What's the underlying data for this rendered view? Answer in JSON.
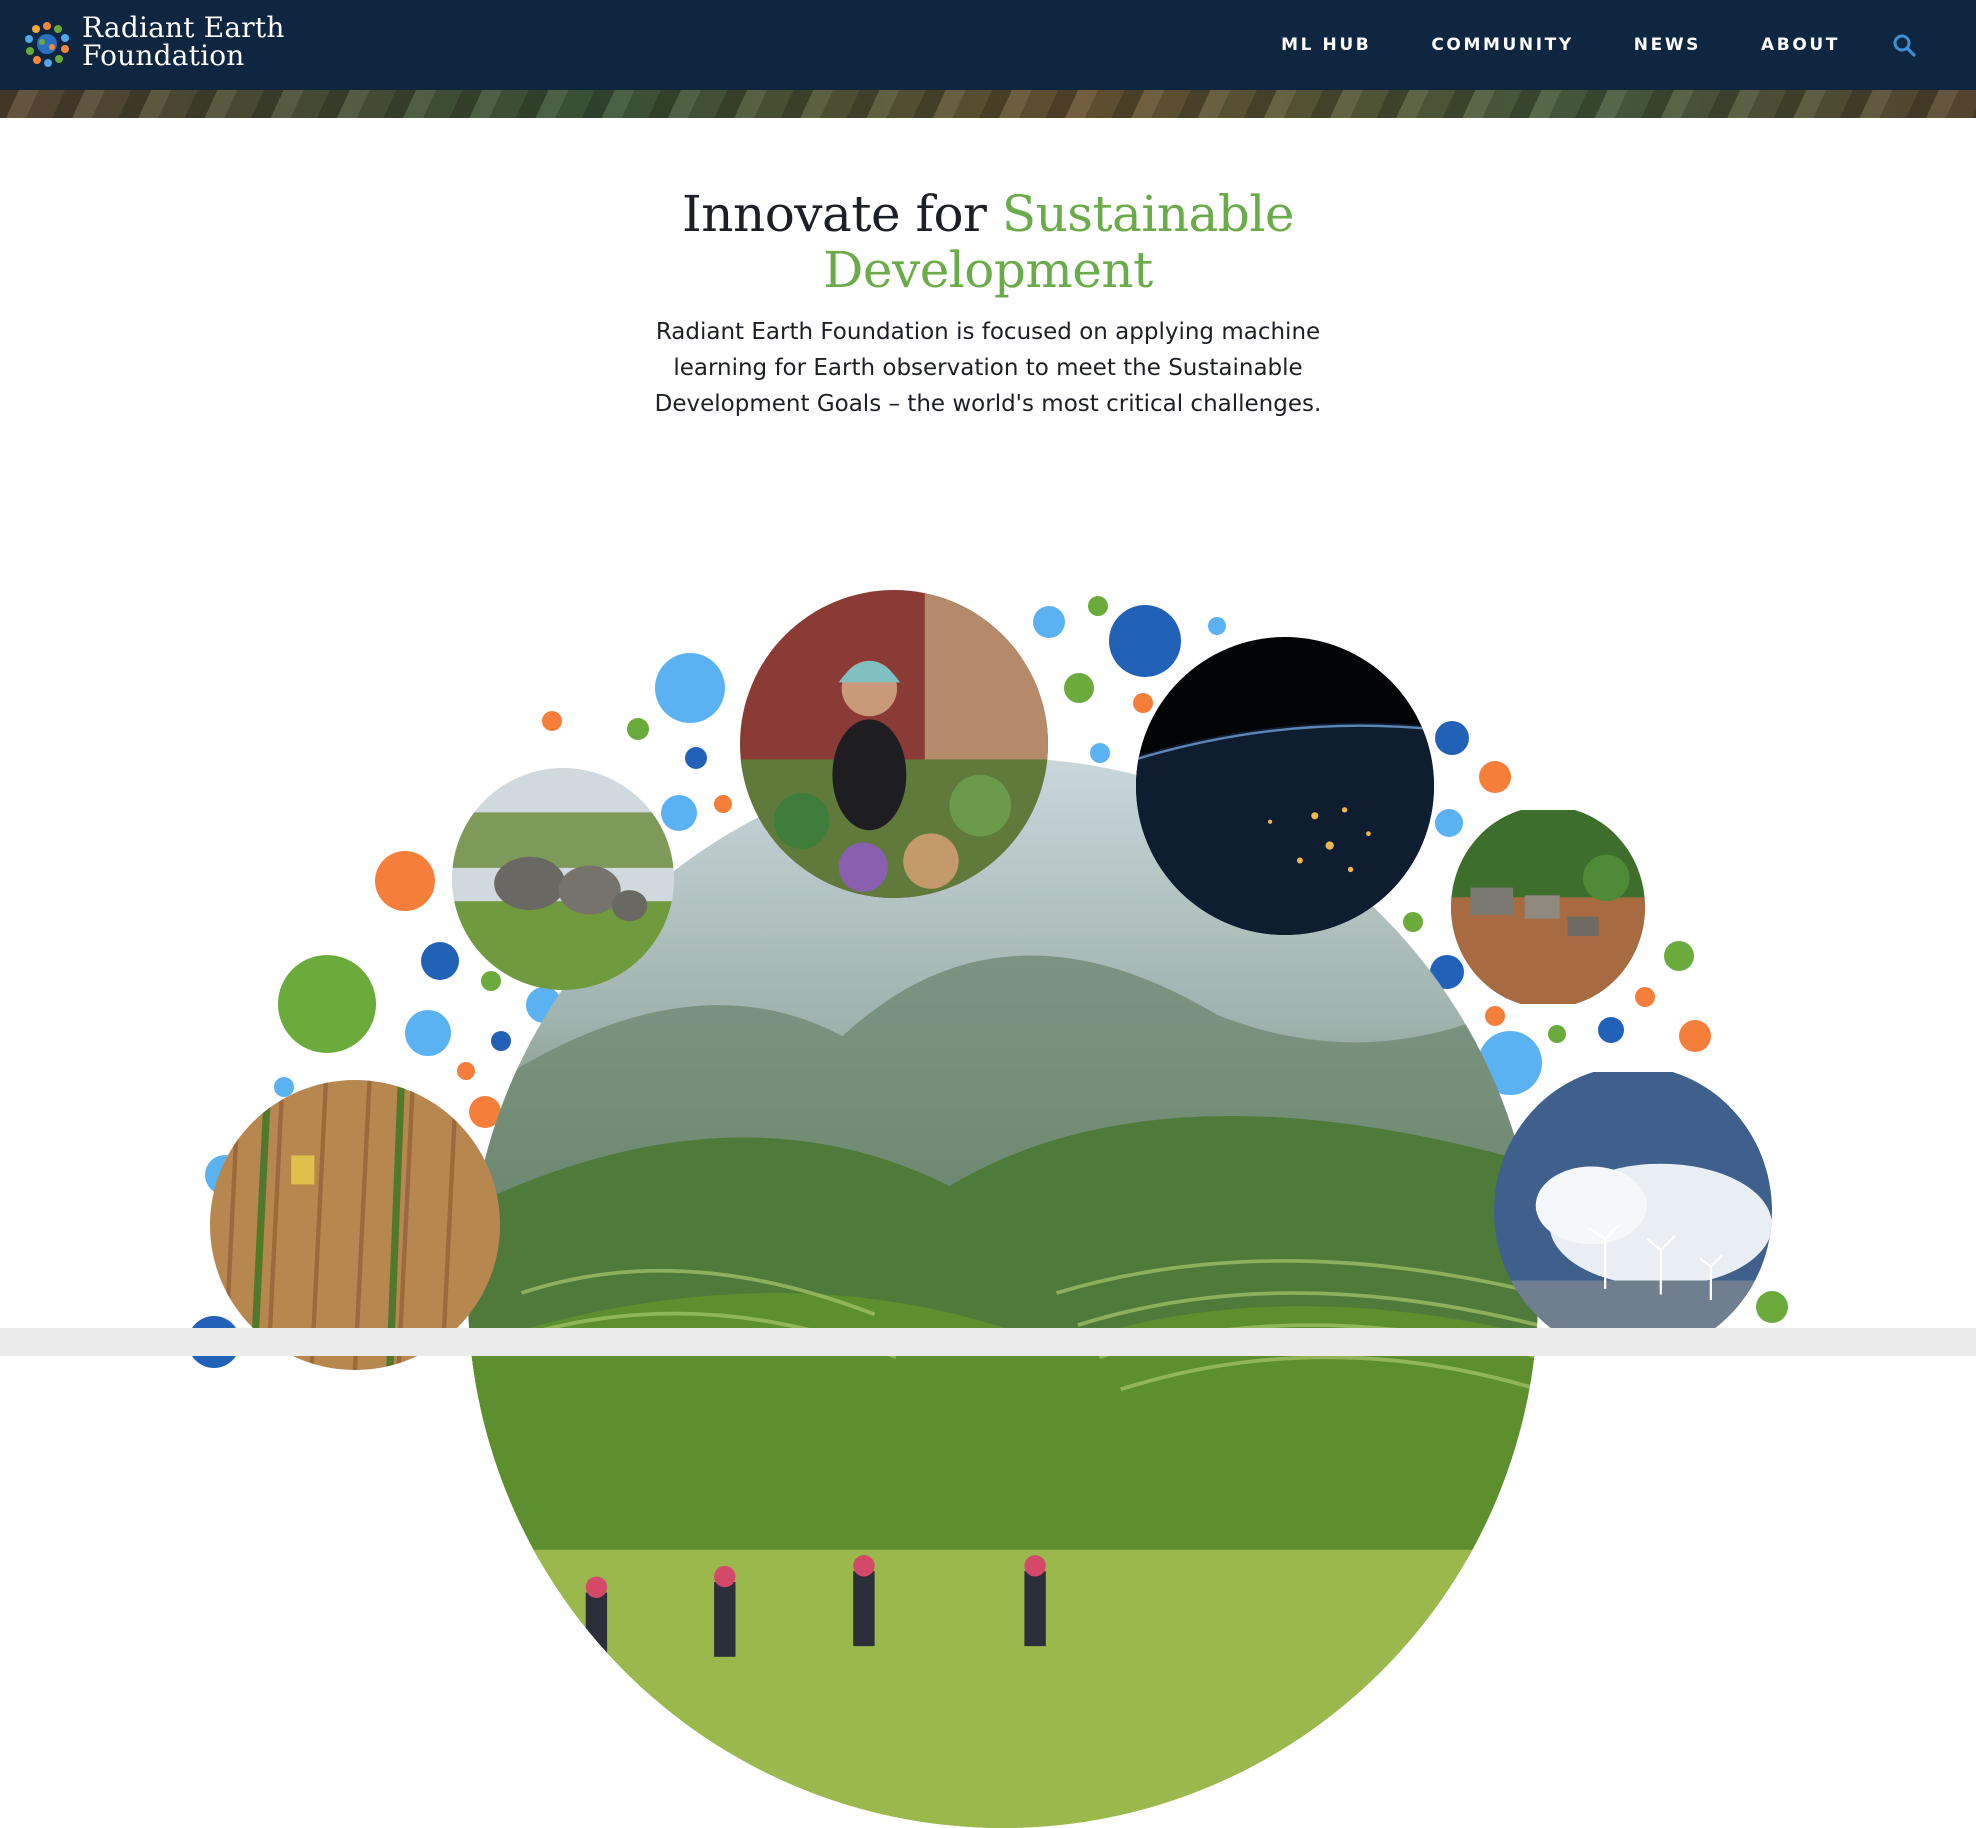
{
  "brand": {
    "line1": "Radiant Earth",
    "line2": "Foundation"
  },
  "nav": {
    "items": [
      "ML HUB",
      "COMMUNITY",
      "NEWS",
      "ABOUT"
    ],
    "search_icon": "search-icon"
  },
  "hero": {
    "headline_part1": "Innovate for ",
    "headline_highlight_line1": "Sustainable",
    "headline_highlight_line2": "Development",
    "intro": "Radiant Earth Foundation is focused on applying machine learning for Earth observation to meet the Sustainable Development Goals – the world's most critical challenges."
  },
  "colors": {
    "nav_background": "#0f2640",
    "accent_green": "#6aab4a",
    "text_dark": "#1d1f27",
    "dot_orange": "#f57f3a",
    "dot_light_blue": "#5bb2f2",
    "dot_dark_blue": "#2162b8",
    "dot_green": "#6aab3c",
    "search_icon_color": "#3f8fd8"
  },
  "collage_images": [
    "rice-terrace-farmers-photo",
    "girl-at-vegetable-market-photo",
    "elephants-photo",
    "earth-night-lights-photo",
    "rural-village-photo",
    "harvester-wheat-field-photo",
    "wind-turbines-clouds-photo"
  ]
}
